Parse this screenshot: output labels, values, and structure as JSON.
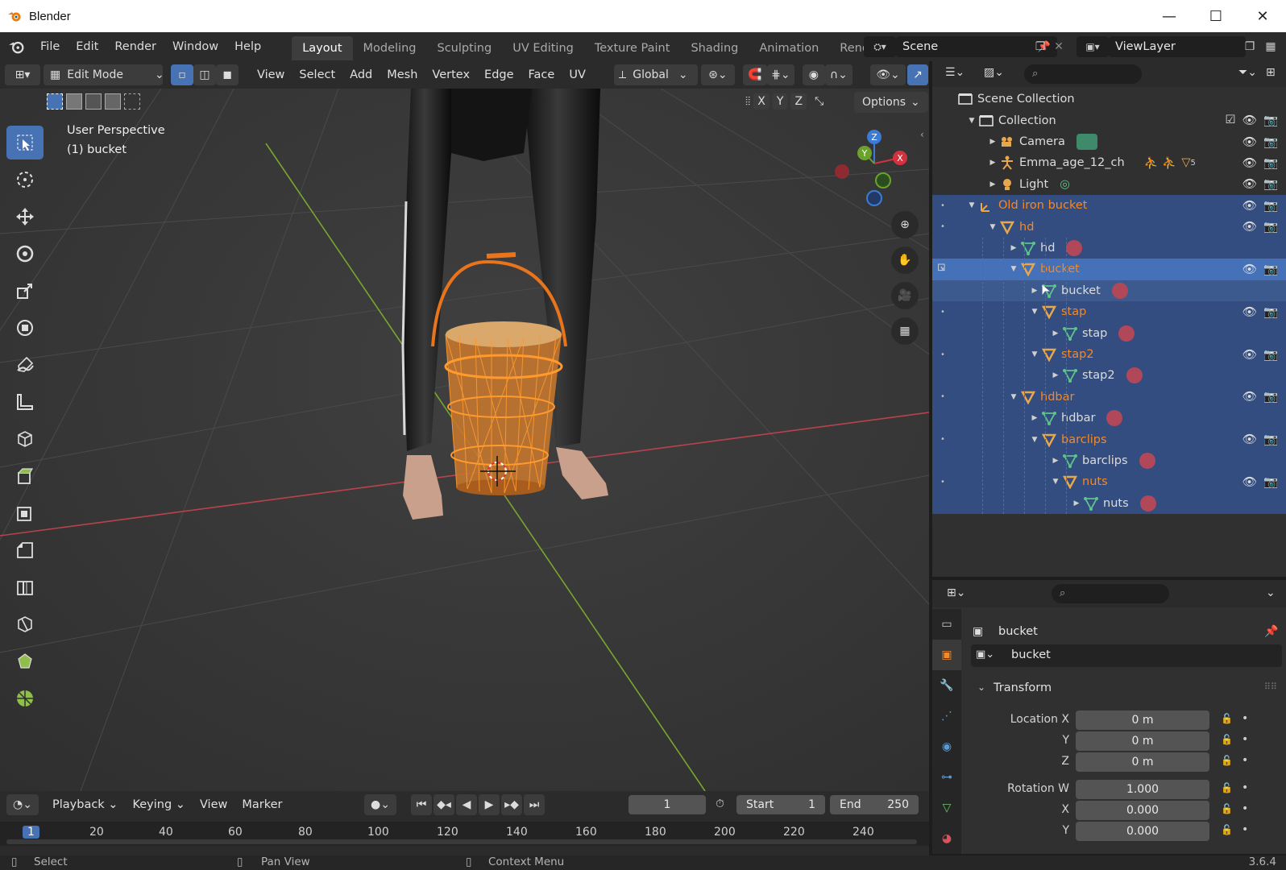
{
  "window": {
    "title": "Blender",
    "minimize": "—",
    "maximize": "☐",
    "close": "✕"
  },
  "menubar": {
    "menus": [
      "File",
      "Edit",
      "Render",
      "Window",
      "Help"
    ],
    "workspaces": [
      "Layout",
      "Modeling",
      "Sculpting",
      "UV Editing",
      "Texture Paint",
      "Shading",
      "Animation",
      "Rendering"
    ],
    "active_workspace": "Layout",
    "scene": "Scene",
    "view_layer": "ViewLayer"
  },
  "viewport_header": {
    "mode": "Edit Mode",
    "menus": [
      "View",
      "Select",
      "Add",
      "Mesh",
      "Vertex",
      "Edge",
      "Face",
      "UV"
    ],
    "transform_orientation": "Global",
    "options": "Options",
    "axes": [
      "X",
      "Y",
      "Z"
    ]
  },
  "viewport": {
    "perspective": "User Perspective",
    "object_info": "(1) bucket",
    "gizmo": {
      "z": "Z",
      "y": "Y",
      "x": "X"
    }
  },
  "outliner": {
    "rows": [
      {
        "label": "Scene Collection",
        "indent": 0,
        "icon": "scene-collection-icon",
        "state": "",
        "orange": false,
        "tri": ""
      },
      {
        "label": "Collection",
        "indent": 1,
        "icon": "collection-icon",
        "state": "",
        "orange": false,
        "tri": "▼"
      },
      {
        "label": "Camera",
        "indent": 2,
        "icon": "camera-icon",
        "state": "",
        "orange": false,
        "tri": "▶"
      },
      {
        "label": "Emma_age_12_ch",
        "indent": 2,
        "icon": "armature-icon",
        "state": "",
        "orange": false,
        "tri": "▶"
      },
      {
        "label": "Light",
        "indent": 2,
        "icon": "light-icon",
        "state": "",
        "orange": false,
        "tri": "▶"
      },
      {
        "label": "Old iron bucket",
        "indent": 1,
        "icon": "empty-icon",
        "state": "sel",
        "orange": true,
        "tri": "▼"
      },
      {
        "label": "hd",
        "indent": 2,
        "icon": "mesh-object-icon",
        "state": "sel",
        "orange": true,
        "tri": "▼"
      },
      {
        "label": "hd",
        "indent": 3,
        "icon": "mesh-data-icon",
        "state": "sel",
        "orange": false,
        "tri": "▶"
      },
      {
        "label": "bucket",
        "indent": 3,
        "icon": "mesh-object-icon",
        "state": "hl",
        "orange": true,
        "tri": "▼"
      },
      {
        "label": "bucket",
        "indent": 4,
        "icon": "mesh-data-icon",
        "state": "hover",
        "orange": false,
        "tri": "▶"
      },
      {
        "label": "stap",
        "indent": 4,
        "icon": "mesh-object-icon",
        "state": "sel",
        "orange": true,
        "tri": "▼"
      },
      {
        "label": "stap",
        "indent": 5,
        "icon": "mesh-data-icon",
        "state": "sel",
        "orange": false,
        "tri": "▶"
      },
      {
        "label": "stap2",
        "indent": 4,
        "icon": "mesh-object-icon",
        "state": "sel",
        "orange": true,
        "tri": "▼"
      },
      {
        "label": "stap2",
        "indent": 5,
        "icon": "mesh-data-icon",
        "state": "sel",
        "orange": false,
        "tri": "▶"
      },
      {
        "label": "hdbar",
        "indent": 3,
        "icon": "mesh-object-icon",
        "state": "sel",
        "orange": true,
        "tri": "▼"
      },
      {
        "label": "hdbar",
        "indent": 4,
        "icon": "mesh-data-icon",
        "state": "sel",
        "orange": false,
        "tri": "▶"
      },
      {
        "label": "barclips",
        "indent": 4,
        "icon": "mesh-object-icon",
        "state": "sel",
        "orange": true,
        "tri": "▼"
      },
      {
        "label": "barclips",
        "indent": 5,
        "icon": "mesh-data-icon",
        "state": "sel",
        "orange": false,
        "tri": "▶"
      },
      {
        "label": "nuts",
        "indent": 5,
        "icon": "mesh-object-icon",
        "state": "sel",
        "orange": true,
        "tri": "▼"
      },
      {
        "label": "nuts",
        "indent": 6,
        "icon": "mesh-data-icon",
        "state": "sel",
        "orange": false,
        "tri": "▶"
      }
    ],
    "emma_badge": "5"
  },
  "properties": {
    "object_name": "bucket",
    "data_name": "bucket",
    "panel": "Transform",
    "fields": [
      {
        "label": "Location X",
        "value": "0 m"
      },
      {
        "label": "Y",
        "value": "0 m"
      },
      {
        "label": "Z",
        "value": "0 m"
      },
      {
        "label": "Rotation W",
        "value": "1.000"
      },
      {
        "label": "X",
        "value": "0.000"
      },
      {
        "label": "Y",
        "value": "0.000"
      }
    ]
  },
  "timeline": {
    "menus": [
      "Playback",
      "Keying",
      "View",
      "Marker"
    ],
    "current_frame": "1",
    "start_label": "Start",
    "start": "1",
    "end_label": "End",
    "end": "250",
    "ruler": [
      "1",
      "20",
      "40",
      "60",
      "80",
      "100",
      "120",
      "140",
      "160",
      "180",
      "200",
      "220",
      "240"
    ]
  },
  "statusbar": {
    "select": "Select",
    "pan": "Pan View",
    "context": "Context Menu",
    "version": "3.6.4"
  },
  "colors": {
    "accent": "#4772b3",
    "selection": "#334d80",
    "orange": "#f08a2a"
  }
}
